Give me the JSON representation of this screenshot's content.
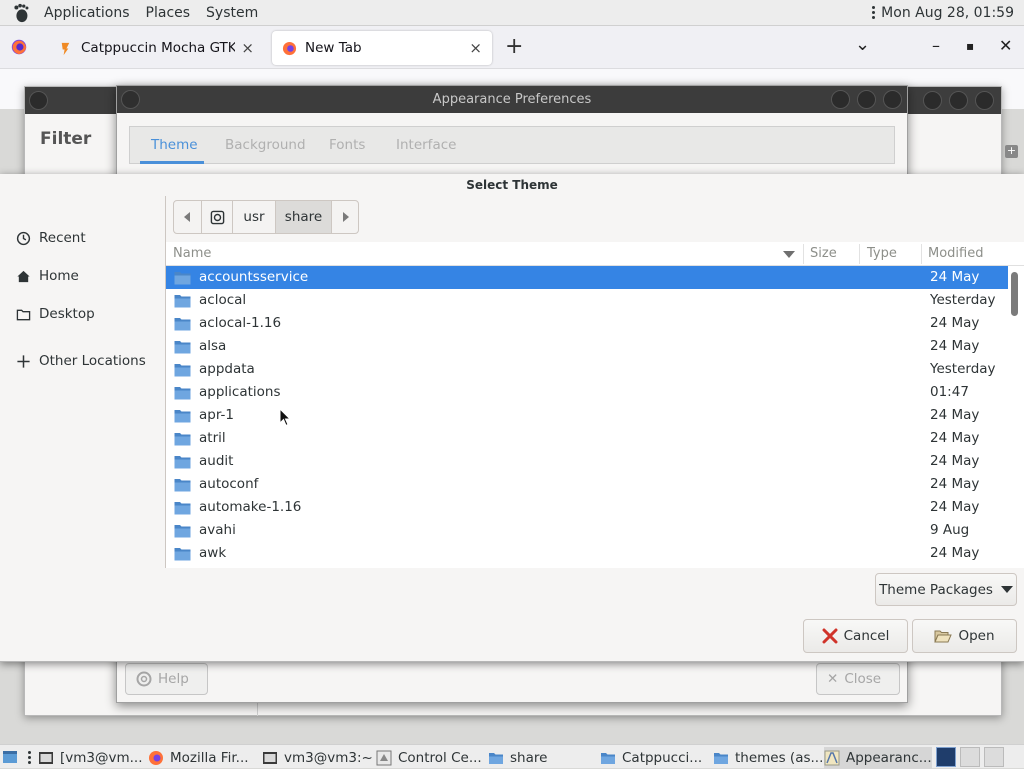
{
  "top_panel": {
    "menus": [
      "Applications",
      "Places",
      "System"
    ],
    "clock": "Mon Aug 28, 01:59"
  },
  "firefox": {
    "tabs": [
      {
        "label": "Catppuccin Mocha GTK Them",
        "close": "×"
      },
      {
        "label": "New Tab",
        "close": "×"
      }
    ],
    "new_tab": "+",
    "list_all_tabs": "⌄",
    "minimize": "–",
    "maximize": "▪",
    "close": "✕"
  },
  "control_center": {
    "filter_label": "Filter"
  },
  "appearance": {
    "title": "Appearance Preferences",
    "tabs": [
      "Theme",
      "Background",
      "Fonts",
      "Interface"
    ],
    "help_label": "Help",
    "close_label": "Close"
  },
  "chooser": {
    "title": "Select Theme",
    "places": [
      {
        "label": "Recent",
        "icon": "clock-icon"
      },
      {
        "label": "Home",
        "icon": "home-icon"
      },
      {
        "label": "Desktop",
        "icon": "folder-icon"
      },
      {
        "label": "Other Locations",
        "icon": "plus-icon"
      }
    ],
    "path": [
      "usr",
      "share"
    ],
    "columns": {
      "name": "Name",
      "size": "Size",
      "type": "Type",
      "modified": "Modified"
    },
    "files": [
      {
        "name": "accountsservice",
        "modified": "24 May",
        "selected": true
      },
      {
        "name": "aclocal",
        "modified": "Yesterday"
      },
      {
        "name": "aclocal-1.16",
        "modified": "24 May"
      },
      {
        "name": "alsa",
        "modified": "24 May"
      },
      {
        "name": "appdata",
        "modified": "Yesterday"
      },
      {
        "name": "applications",
        "modified": "01:47"
      },
      {
        "name": "apr-1",
        "modified": "24 May"
      },
      {
        "name": "atril",
        "modified": "24 May"
      },
      {
        "name": "audit",
        "modified": "24 May"
      },
      {
        "name": "autoconf",
        "modified": "24 May"
      },
      {
        "name": "automake-1.16",
        "modified": "24 May"
      },
      {
        "name": "avahi",
        "modified": "9 Aug"
      },
      {
        "name": "awk",
        "modified": "24 May"
      }
    ],
    "filter": "Theme Packages",
    "cancel_label": "Cancel",
    "open_label": "Open"
  },
  "taskbar": {
    "tasks": [
      {
        "label": "[vm3@vm...",
        "icon": "terminal-icon"
      },
      {
        "label": "Mozilla Fir...",
        "icon": "firefox-icon"
      },
      {
        "label": "vm3@vm3:~",
        "icon": "terminal-icon"
      },
      {
        "label": "Control Ce...",
        "icon": "control-center-icon"
      },
      {
        "label": "share",
        "icon": "folder-icon"
      },
      {
        "label": "Catppucci...",
        "icon": "folder-icon"
      },
      {
        "label": "themes (as...",
        "icon": "folder-icon"
      },
      {
        "label": "Appearanc...",
        "icon": "appearance-icon",
        "active": true
      }
    ]
  },
  "colors": {
    "selection": "#3584e4",
    "folder": "#5b9bd5",
    "titlebar_dark": "#3c3c3c",
    "tab_accent": "#4a90d9"
  }
}
